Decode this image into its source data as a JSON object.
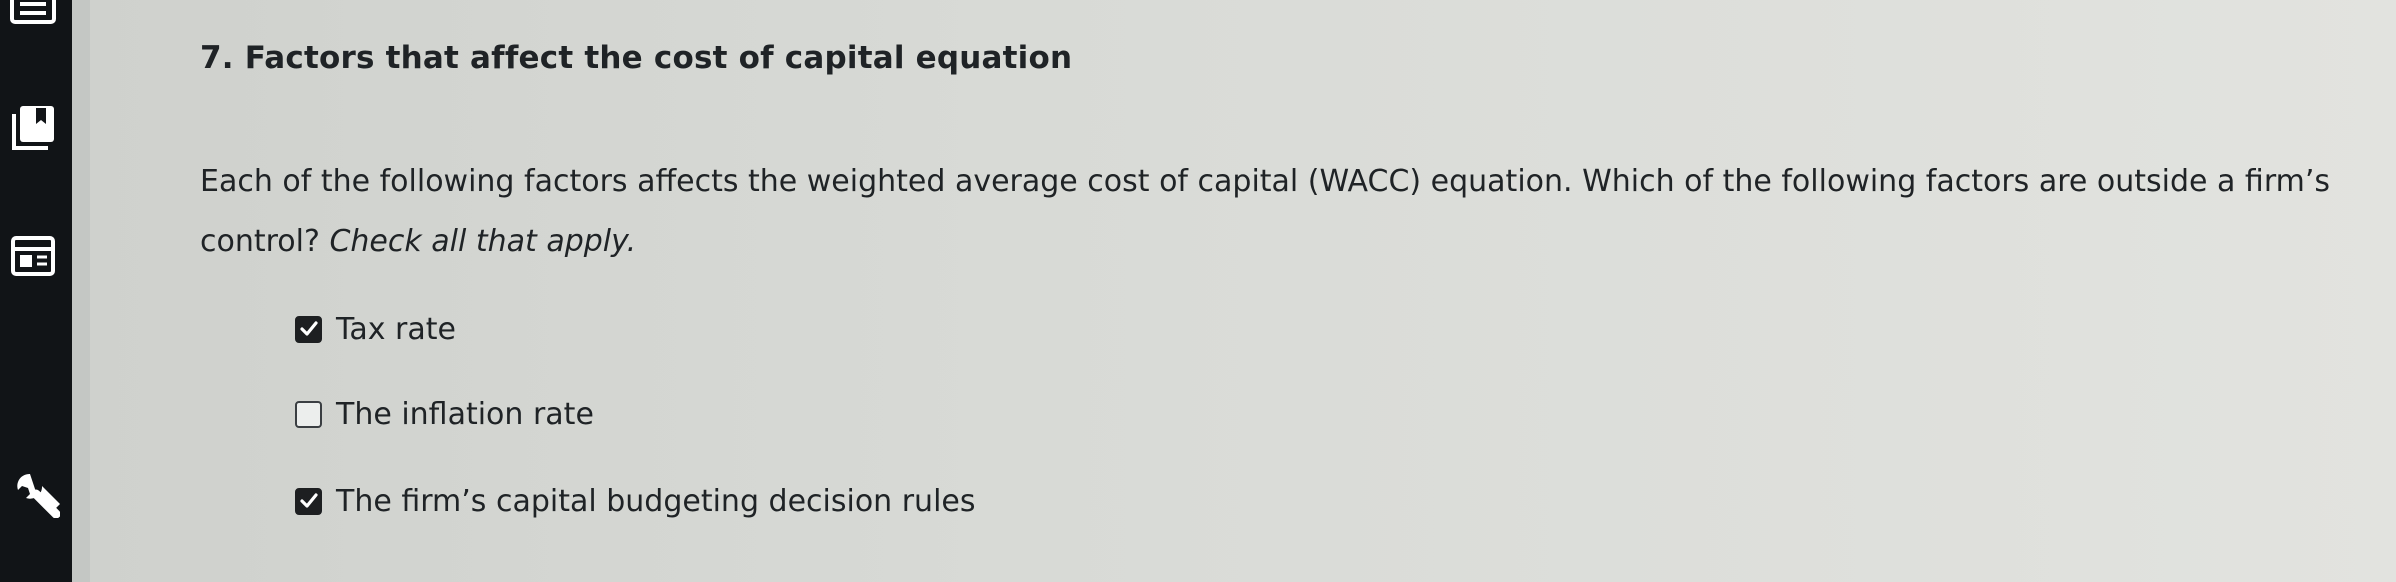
{
  "sidebar": {
    "icons": [
      "list-icon",
      "bookmark-icon",
      "panel-icon",
      "wrench-icon"
    ]
  },
  "question": {
    "title": "7. Factors that affect the cost of capital equation",
    "prompt": "Each of the following factors affects the weighted average cost of capital (WACC) equation. Which of the following factors are outside a firm’s control?",
    "instruction": "Check all that apply."
  },
  "options": [
    {
      "label": "Tax rate",
      "checked": true
    },
    {
      "label": "The inflation rate",
      "checked": false
    },
    {
      "label": "The firm’s capital budgeting decision rules",
      "checked": true
    }
  ],
  "colors": {
    "sidebar": "#111417",
    "page": "#d3d5d1",
    "text": "#1f2326",
    "checkbox_checked": "#1d1f21"
  }
}
